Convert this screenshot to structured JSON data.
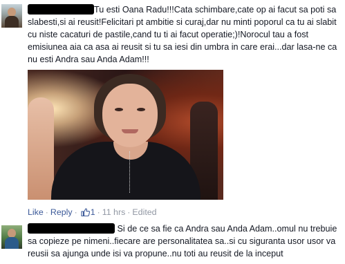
{
  "comments": [
    {
      "text": "Tu esti Oana Radu!!!Cata schimbare,cate op ai facut sa poti sa slabesti,si ai reusit!Felicitari pt ambitie si curaj,dar nu minti poporul ca tu ai slabit cu niste cacaturi de pastile,cand tu ti ai facut operatie;)!Norocul tau a fost emisiunea aia ca asa ai reusit si tu sa iesi din umbra in care erai...dar lasa-ne ca nu esti Andra sau Anda Adam!!!",
      "actions": {
        "like": "Like",
        "reply": "Reply",
        "like_count": "1",
        "time": "11 hrs",
        "edited": "Edited"
      }
    },
    {
      "text": "Si de ce sa fie ca Andra sau Anda Adam..omul nu trebuie sa copieze pe nimeni..fiecare are personalitatea sa..si cu siguranta usor usor va reusii sa ajunga unde isi va propune..nu toti au reusit de la inceput"
    }
  ],
  "icons": {
    "like_thumb": "thumbs-up-icon"
  },
  "colors": {
    "link": "#3b5998",
    "meta": "#9197a3",
    "text": "#141823",
    "redaction": "#000000"
  }
}
